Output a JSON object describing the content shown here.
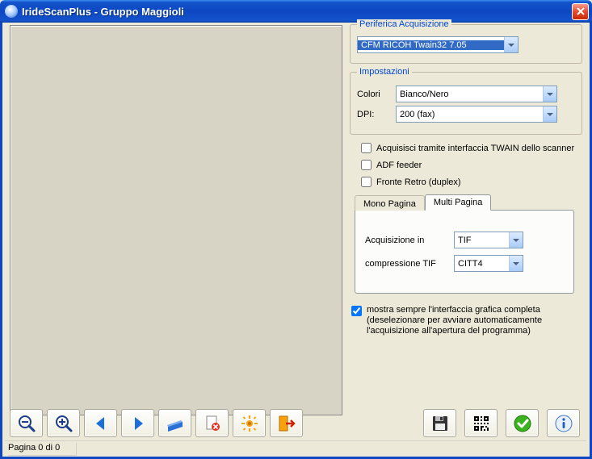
{
  "window": {
    "title": "IrideScanPlus - Gruppo Maggioli"
  },
  "device_group": {
    "legend": "Periferica Acquisizione",
    "selected": "CFM RICOH Twain32 7.05"
  },
  "settings_group": {
    "legend": "Impostazioni",
    "color_label": "Colori",
    "color_value": "Bianco/Nero",
    "dpi_label": "DPI:",
    "dpi_value": "200 (fax)"
  },
  "checkboxes": {
    "twain": "Acquisisci tramite interfaccia TWAIN dello scanner",
    "adf": "ADF feeder",
    "duplex": "Fronte Retro (duplex)"
  },
  "tabs": {
    "mono": "Mono Pagina",
    "multi": "Multi Pagina",
    "acq_label": "Acquisizione in",
    "acq_value": "TIF",
    "comp_label": "compressione TIF",
    "comp_value": "CITT4"
  },
  "show_interface": {
    "line1": "mostra sempre l'interfaccia grafica completa",
    "line2": "(deselezionare per avviare automaticamente",
    "line3": "l'acquisizione all'apertura del programma)"
  },
  "status": {
    "page": "Pagina 0 di 0"
  }
}
